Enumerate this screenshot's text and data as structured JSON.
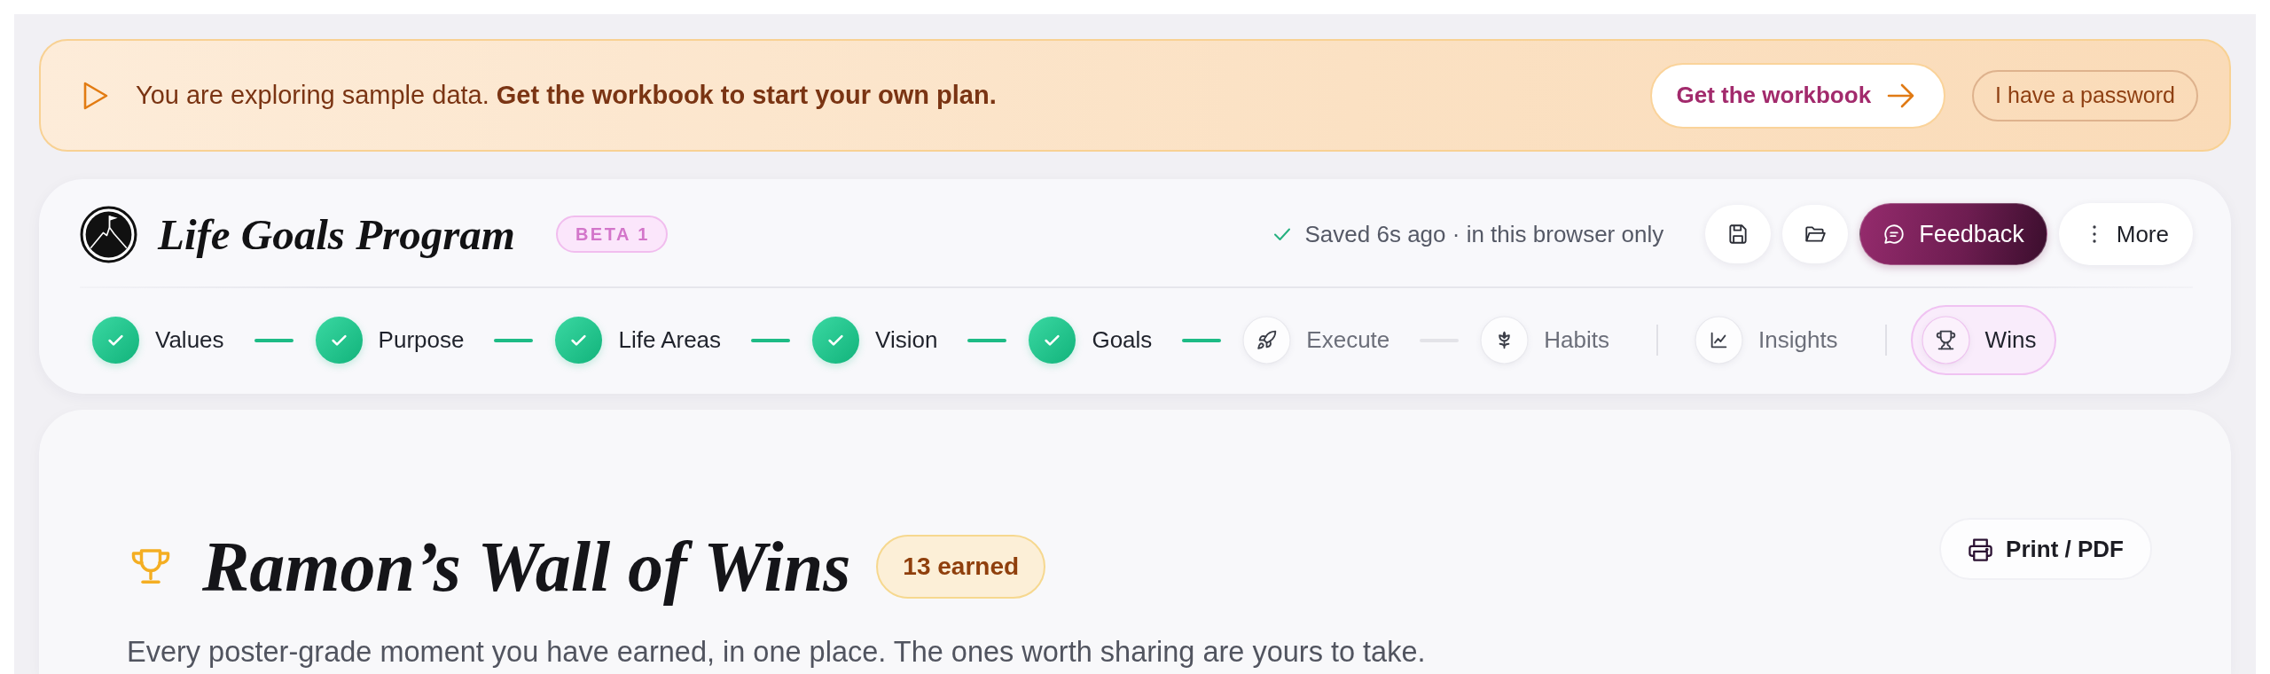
{
  "banner": {
    "message": "You are exploring sample data. **Get the workbook to start your own plan.**",
    "primary_button": "Get the workbook",
    "secondary_button": "I have a password"
  },
  "header": {
    "title": "Life Goals Program",
    "badge": "BETA 1",
    "save_status": "Saved 6s ago · in this browser only",
    "feedback_button": "Feedback",
    "more_button": "More"
  },
  "nav": [
    {
      "label": "Values",
      "kind": "step",
      "done": true,
      "selected": false
    },
    {
      "label": "Purpose",
      "kind": "step",
      "done": true,
      "selected": false
    },
    {
      "label": "Life Areas",
      "kind": "step",
      "done": true,
      "selected": false
    },
    {
      "label": "Vision",
      "kind": "step",
      "done": true,
      "selected": false
    },
    {
      "label": "Goals",
      "kind": "step",
      "done": true,
      "selected": false
    },
    {
      "label": "Execute",
      "kind": "step",
      "done": false,
      "selected": false
    },
    {
      "label": "Habits",
      "kind": "step",
      "done": false,
      "selected": false
    },
    {
      "label": "Insights",
      "kind": "section",
      "done": false,
      "selected": false
    },
    {
      "label": "Wins",
      "kind": "section",
      "done": false,
      "selected": true
    }
  ],
  "wins_page": {
    "title": "Ramon’s Wall of Wins",
    "count": "13 earned",
    "subtitle": "Every poster-grade moment you have earned, in one place. The ones worth sharing are yours to take.",
    "print_button": "Print / PDF"
  }
}
